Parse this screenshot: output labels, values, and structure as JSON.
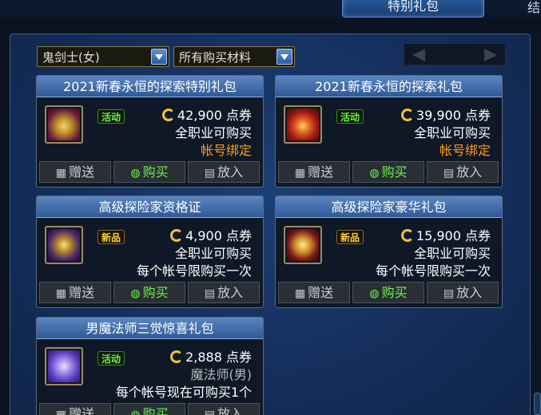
{
  "tabs": {
    "special_pack": "特别礼包",
    "next_partial": "结"
  },
  "filters": {
    "class_select": "鬼剑士(女)",
    "material_select": "所有购买材料"
  },
  "cards": [
    {
      "title": "2021新春永恒的探索特别礼包",
      "badge": "活动",
      "badge_type": "activity",
      "price": "42,900 点券",
      "line1": "全职业可购买",
      "line2": "帐号绑定",
      "line2_color": "#ff9c1a",
      "icon": "golden-chest-icon",
      "actions": {
        "gift": "赠送",
        "buy": "购买",
        "equip": "放入"
      }
    },
    {
      "title": "2021新春永恒的探索礼包",
      "badge": "活动",
      "badge_type": "activity",
      "price": "39,900 点券",
      "line1": "全职业可购买",
      "line2": "帐号绑定",
      "line2_color": "#ff9c1a",
      "icon": "red-chest-icon",
      "actions": {
        "gift": "赠送",
        "buy": "购买",
        "equip": "放入"
      }
    },
    {
      "title": "高级探险家资格证",
      "badge": "新品",
      "badge_type": "new",
      "price": "4,900 点券",
      "line1": "全职业可购买",
      "line2": "每个帐号限购买一次",
      "line2_color": "#ffffff",
      "icon": "explorer-certificate-icon",
      "actions": {
        "gift": "赠送",
        "buy": "购买",
        "equip": "放入"
      }
    },
    {
      "title": "高级探险家豪华礼包",
      "badge": "新品",
      "badge_type": "new",
      "price": "15,900 点券",
      "line1": "全职业可购买",
      "line2": "每个帐号限购买一次",
      "line2_color": "#ffffff",
      "icon": "explorer-deluxe-pack-icon",
      "actions": {
        "gift": "赠送",
        "buy": "购买",
        "equip": "放入"
      }
    },
    {
      "title": "男魔法师三觉惊喜礼包",
      "badge": "活动",
      "badge_type": "activity",
      "price": "2,888 点券",
      "line1": "魔法师(男)",
      "line2": "每个帐号现在可购买1个",
      "line2_color": "#ffffff",
      "icon": "purple-mage-pack-icon",
      "actions": {
        "gift": "赠送",
        "buy": "购买",
        "equip": "放入"
      }
    }
  ]
}
